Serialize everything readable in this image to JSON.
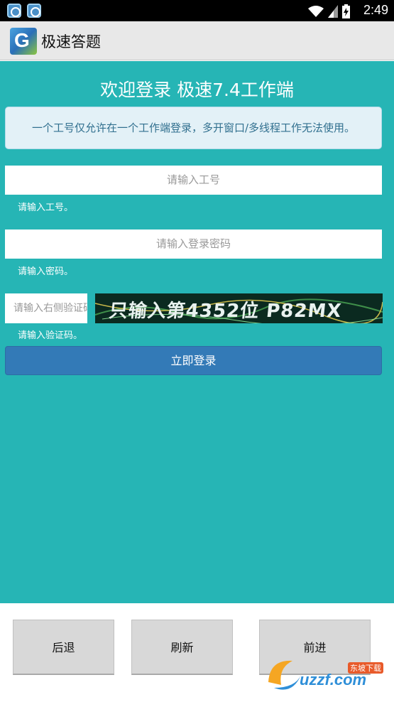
{
  "status_bar": {
    "time": "2:49",
    "icons": [
      "app-notification-icon",
      "app-notification-icon",
      "wifi-icon",
      "signal-icon",
      "battery-charging-icon"
    ]
  },
  "app_bar": {
    "title": "极速答题",
    "logo_letter": "G"
  },
  "login": {
    "welcome": "欢迎登录 极速7.4工作端",
    "notice": "一个工号仅允许在一个工作端登录，多开窗口/多线程工作无法使用。",
    "id_placeholder": "请输入工号",
    "id_helper": "请输入工号。",
    "password_placeholder": "请输入登录密码",
    "password_helper": "请输入密码。",
    "captcha_placeholder": "请输入右侧验证码",
    "captcha_helper": "请输入验证码。",
    "captcha_text": "只输入第4352位 P82MX",
    "login_button": "立即登录"
  },
  "nav": {
    "back": "后退",
    "refresh": "刷新",
    "forward": "前进"
  },
  "watermark": {
    "site": "uzzf.com",
    "tag": "东坡下载"
  },
  "colors": {
    "main_bg": "#26b5b5",
    "button_blue": "#337ab7",
    "notice_text": "#31708f"
  }
}
